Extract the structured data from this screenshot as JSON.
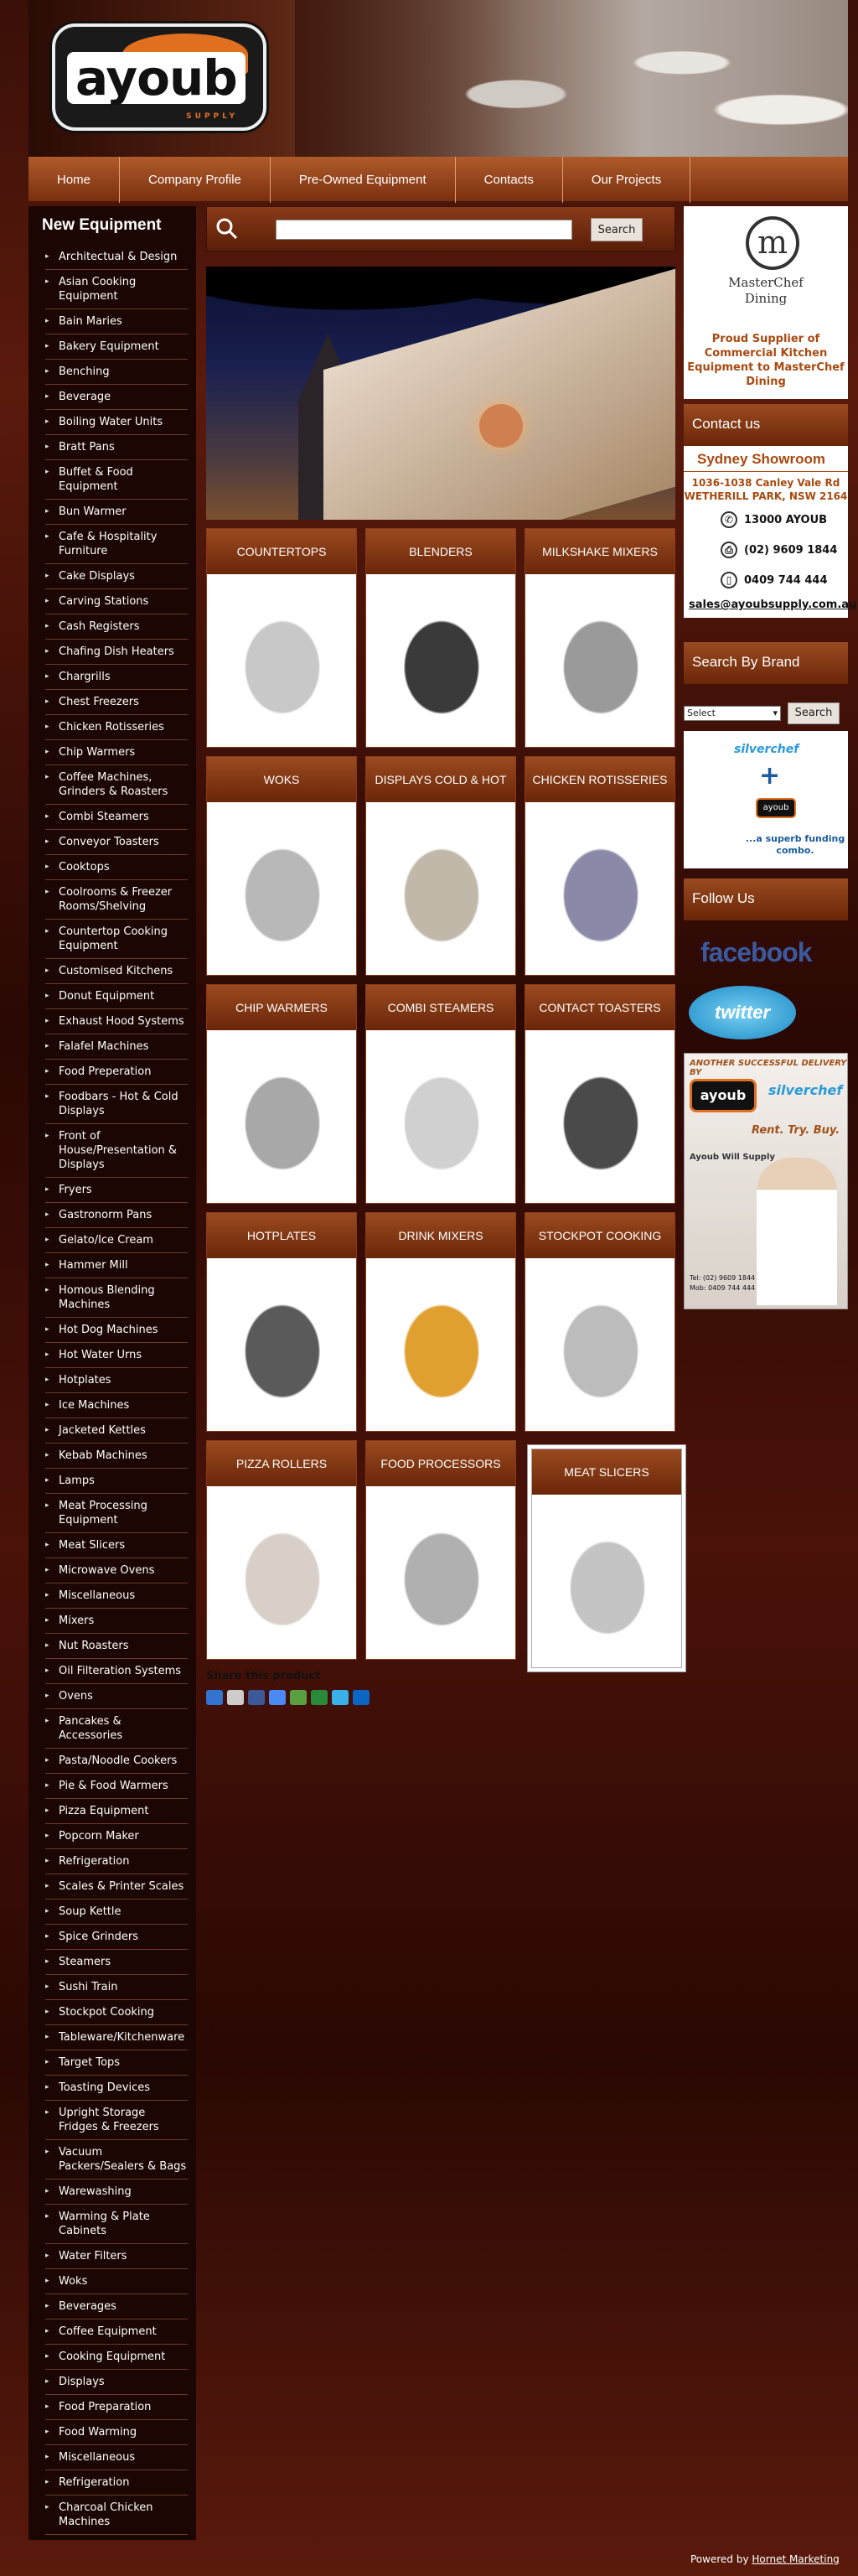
{
  "logo": {
    "word": "ayoub",
    "tag": "SUPPLY"
  },
  "nav": [
    "Home",
    "Company Profile",
    "Pre-Owned Equipment",
    "Contacts",
    "Our Projects"
  ],
  "sidebar": {
    "title": "New Equipment",
    "items": [
      "Architectual & Design",
      "Asian Cooking Equipment",
      "Bain Maries",
      "Bakery Equipment",
      "Benching",
      "Beverage",
      "Boiling Water Units",
      "Bratt Pans",
      "Buffet & Food Equipment",
      "Bun Warmer",
      "Cafe & Hospitality Furniture",
      "Cake Displays",
      "Carving Stations",
      "Cash Registers",
      "Chafing Dish Heaters",
      "Chargrills",
      "Chest Freezers",
      "Chicken Rotisseries",
      "Chip Warmers",
      "Coffee Machines, Grinders & Roasters",
      "Combi Steamers",
      "Conveyor Toasters",
      "Cooktops",
      "Coolrooms & Freezer Rooms/Shelving",
      "Countertop Cooking Equipment",
      "Customised Kitchens",
      "Donut Equipment",
      "Exhaust Hood Systems",
      "Falafel Machines",
      "Food Preperation",
      "Foodbars - Hot & Cold Displays",
      "Front of House/Presentation & Displays",
      "Fryers",
      "Gastronorm Pans",
      "Gelato/Ice Cream",
      "Hammer Mill",
      "Homous Blending Machines",
      "Hot Dog Machines",
      "Hot Water Urns",
      "Hotplates",
      "Ice Machines",
      "Jacketed Kettles",
      "Kebab Machines",
      "Lamps",
      "Meat Processing Equipment",
      "Meat Slicers",
      "Microwave Ovens",
      "Miscellaneous",
      "Mixers",
      "Nut Roasters",
      "Oil Filteration Systems",
      "Ovens",
      "Pancakes & Accessories",
      "Pasta/Noodle Cookers",
      "Pie & Food Warmers",
      "Pizza Equipment",
      "Popcorn Maker",
      "Refrigeration",
      "Scales & Printer Scales",
      "Soup Kettle",
      "Spice Grinders",
      "Steamers",
      "Sushi Train",
      "Stockpot Cooking",
      "Tableware/Kitchenware",
      "Target Tops",
      "Toasting Devices",
      "Upright Storage Fridges & Freezers",
      "Vacuum Packers/Sealers & Bags",
      "Warewashing",
      "Warming & Plate Cabinets",
      "Water Filters",
      "Woks",
      "Beverages",
      "Coffee Equipment",
      "Cooking Equipment",
      "Displays",
      "Food Preparation",
      "Food Warming",
      "Miscellaneous",
      "Refrigeration",
      "Charcoal Chicken Machines"
    ]
  },
  "search": {
    "button": "Search",
    "placeholder": ""
  },
  "categories": [
    "COUNTERTOPS",
    "BLENDERS",
    "MILKSHAKE MIXERS",
    "WOKS",
    "DISPLAYS COLD & HOT",
    "CHICKEN ROTISSERIES",
    "CHIP WARMERS",
    "COMBI STEAMERS",
    "CONTACT TOASTERS",
    "HOTPLATES",
    "DRINK MIXERS",
    "STOCKPOT COOKING",
    "PIZZA ROLLERS",
    "FOOD PROCESSORS",
    "MEAT SLICERS"
  ],
  "share": {
    "label": "Share this product"
  },
  "masterchef": {
    "name_line1": "MasterChef",
    "name_line2": "Dining",
    "proud": "Proud Supplier of Commercial Kitchen Equipment to MasterChef Dining"
  },
  "contact": {
    "heading": "Contact us",
    "showroom": "Sydney Showroom",
    "addr1": "1036-1038 Canley Vale Rd",
    "addr2": "WETHERILL PARK, NSW 2164",
    "phone": "13000 AYOUB",
    "fax": "(02) 9609 1844",
    "mobile": "0409 744 444",
    "email": "sales@ayoubsupply.com.au"
  },
  "brand": {
    "heading": "Search By Brand",
    "select": "Select",
    "button": "Search"
  },
  "silverchef": {
    "name": "silverchef",
    "funding": "...a superb funding combo."
  },
  "follow": {
    "heading": "Follow Us",
    "facebook": "facebook",
    "twitter": "twitter"
  },
  "ad": {
    "headline": "ANOTHER SUCCESSFUL DELIVERY BY",
    "logo": "ayoub",
    "partner": "silverchef",
    "tagline": "Rent. Try. Buy.",
    "will_supply": "Ayoub Will Supply",
    "tel": "Tel: (02) 9609 1844",
    "mob": "Mob: 0409 744 444"
  },
  "footer": {
    "prefix": "Powered by",
    "link": "Hornet Marketing"
  },
  "colors": {
    "brand_orange": "#e07020",
    "header_brown": "#7a3010",
    "sidebar_bg": "#1b0603",
    "accent_text": "#a84a10"
  }
}
